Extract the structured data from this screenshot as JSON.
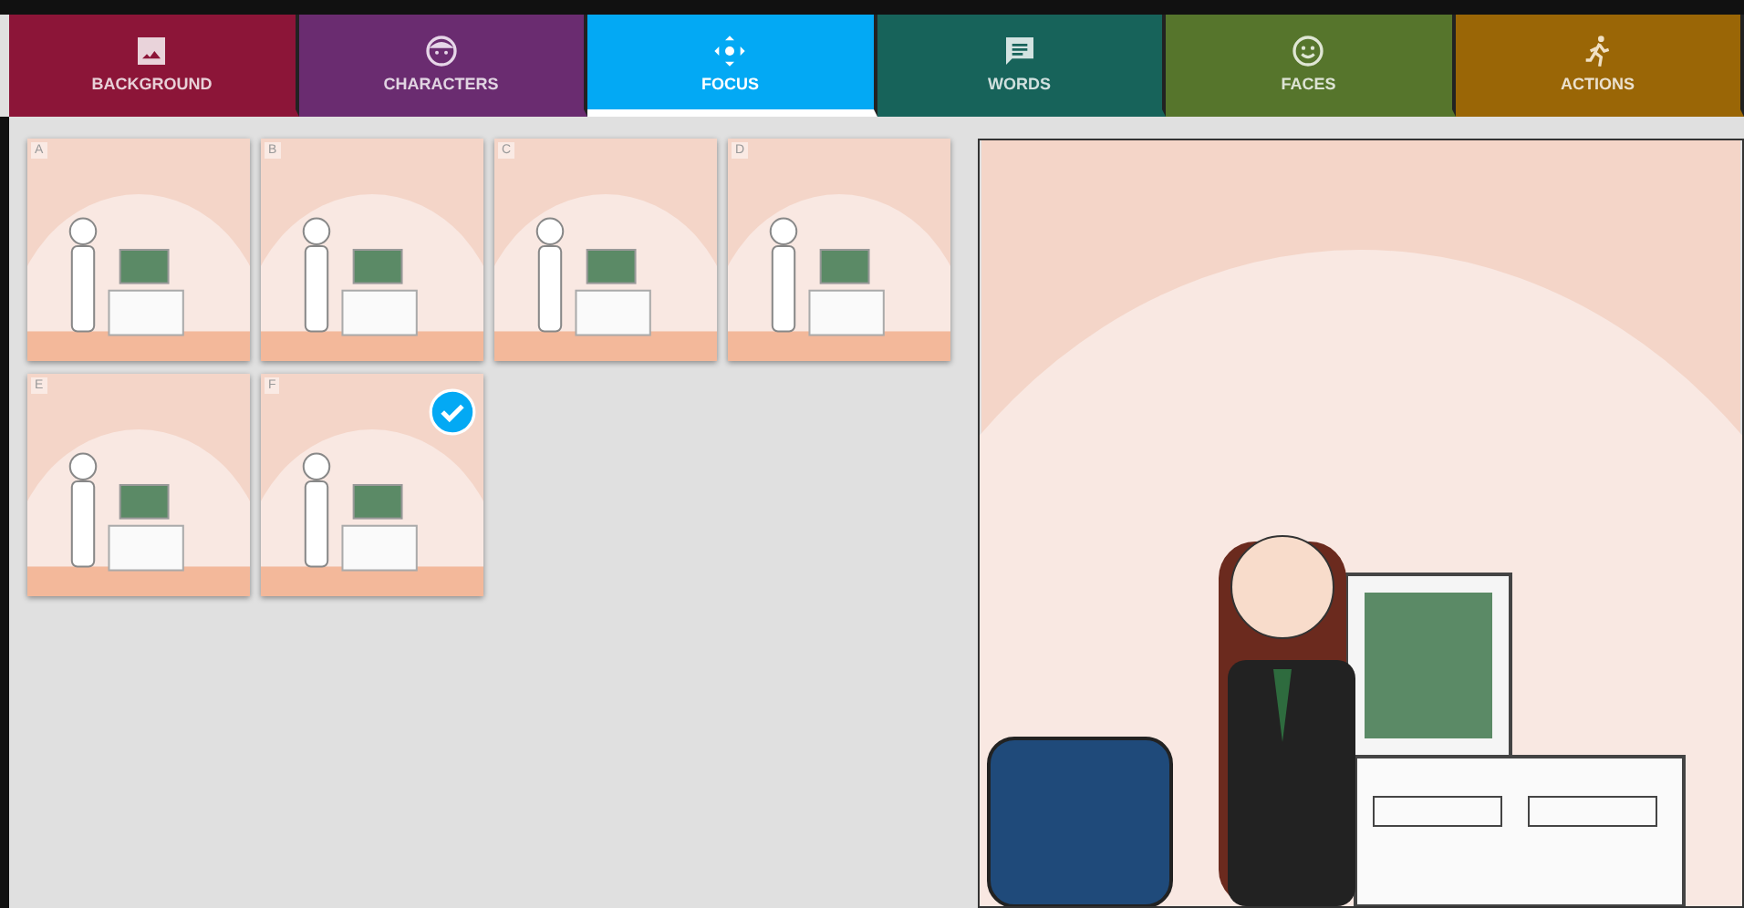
{
  "tabs": [
    {
      "label": "BACKGROUND",
      "color": "#8c1538",
      "selected": false
    },
    {
      "label": "CHARACTERS",
      "color": "#6a2c70",
      "selected": false
    },
    {
      "label": "FOCUS",
      "color": "#03a9f4",
      "selected": true
    },
    {
      "label": "WORDS",
      "color": "#17635a",
      "selected": false
    },
    {
      "label": "FACES",
      "color": "#56752c",
      "selected": false
    },
    {
      "label": "ACTIONS",
      "color": "#9a6606",
      "selected": false
    }
  ],
  "frames": [
    {
      "label": "A",
      "selected": false
    },
    {
      "label": "B",
      "selected": false
    },
    {
      "label": "C",
      "selected": false
    },
    {
      "label": "D",
      "selected": false
    },
    {
      "label": "E",
      "selected": false
    },
    {
      "label": "F",
      "selected": true
    }
  ]
}
